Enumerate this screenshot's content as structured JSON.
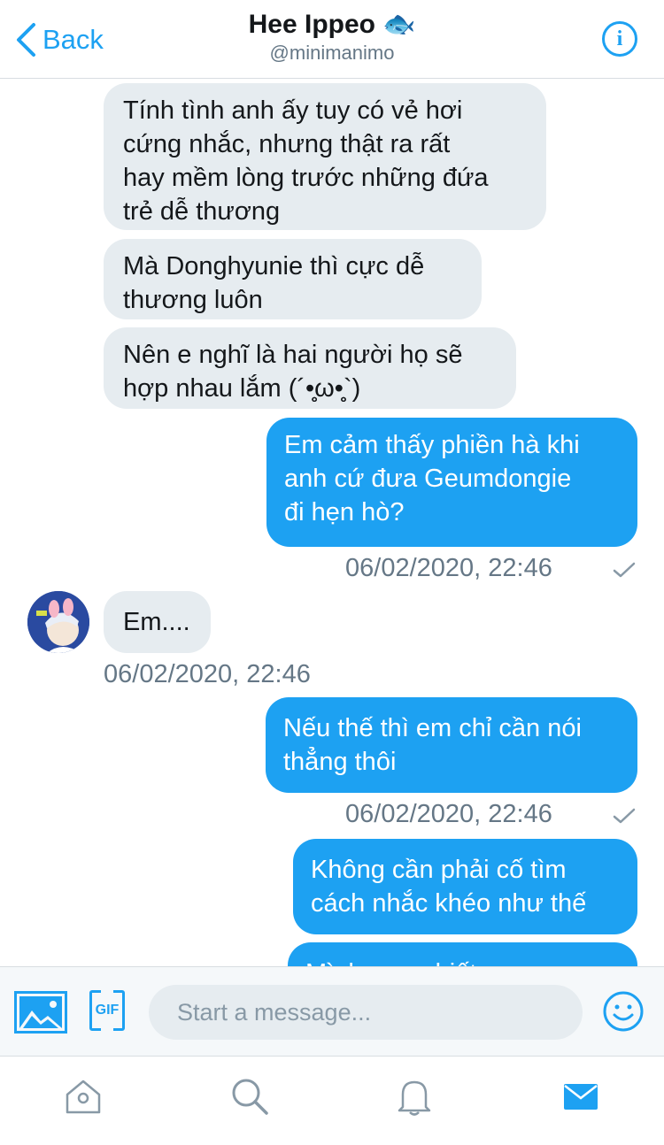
{
  "header": {
    "back_label": "Back",
    "title": "Hee Ippeo",
    "title_emoji": "🐟",
    "handle": "@minimanimo",
    "info_label": "i"
  },
  "messages": [
    {
      "side": "in",
      "lines": [
        "Tính tình anh ấy tuy có vẻ hơi",
        "cứng nhắc, nhưng thật ra rất",
        "hay mềm lòng trước những đứa",
        "trẻ dễ thương"
      ]
    },
    {
      "side": "in",
      "lines": [
        "Mà Donghyunie thì cực dễ",
        "thương luôn"
      ]
    },
    {
      "side": "in",
      "lines": [
        "Nên e nghĩ là hai người họ sẽ",
        "hợp nhau lắm (´•̥̥̥ω•̥̥̥`)"
      ]
    },
    {
      "side": "out",
      "lines": [
        "Em cảm thấy phiền hà khi",
        "anh cứ đưa Geumdongie",
        "đi hẹn hò?"
      ],
      "timestamp": "06/02/2020, 22:46"
    },
    {
      "side": "in",
      "lines": [
        "Em...."
      ],
      "timestamp": "06/02/2020, 22:46"
    },
    {
      "side": "out",
      "lines": [
        "Nếu thế thì em chỉ cần nói",
        "thẳng thôi"
      ],
      "timestamp": "06/02/2020, 22:46"
    },
    {
      "side": "out",
      "lines": [
        "Không cần phải cố tìm",
        "cách nhắc khéo như thế"
      ]
    },
    {
      "side": "out",
      "lines": [
        "Mình … … biết … …"
      ]
    }
  ],
  "composer": {
    "placeholder": "Start a message...",
    "gif_label": "GIF"
  },
  "tabs": [
    "home-icon",
    "search-icon",
    "notifications-icon",
    "messages-icon"
  ],
  "colors": {
    "accent": "#1da1f2",
    "incoming_bubble": "#e6ecf0",
    "muted_text": "#657786"
  }
}
